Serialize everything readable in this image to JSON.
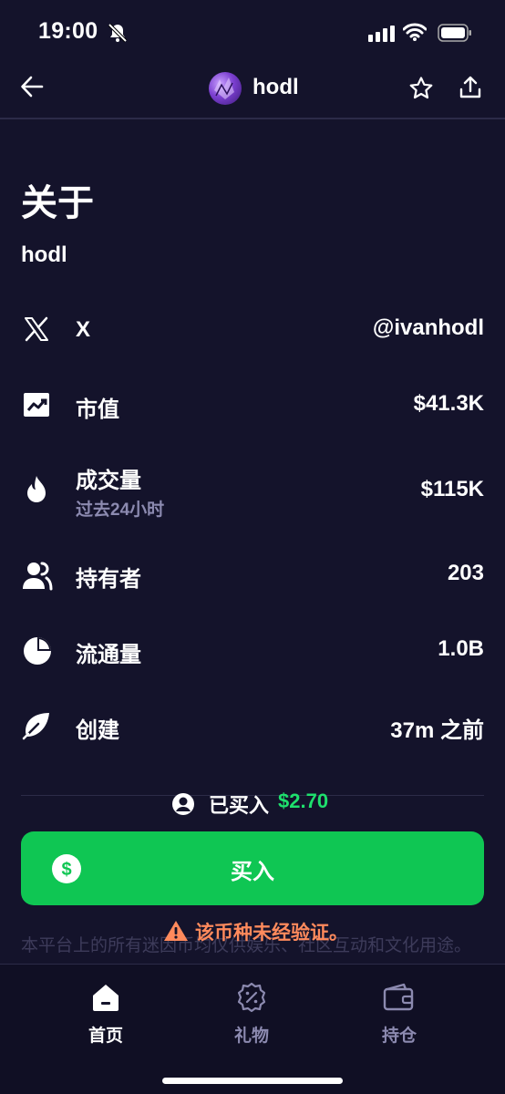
{
  "status_bar": {
    "time": "19:00"
  },
  "header": {
    "token_name": "hodl",
    "icons": [
      "back-arrow-icon",
      "star-icon",
      "share-icon"
    ]
  },
  "about": {
    "title": "关于",
    "token_line": "hodl"
  },
  "stats": [
    {
      "icon": "x-logo-icon",
      "label": "X",
      "value": "@ivanhodl"
    },
    {
      "icon": "trend-up-icon",
      "label": "市值",
      "value": "$41.3K"
    },
    {
      "icon": "flame-icon",
      "label": "成交量",
      "sublabel": "过去24小时",
      "value": "$115K"
    },
    {
      "icon": "users-icon",
      "label": "持有者",
      "value": "203"
    },
    {
      "icon": "pie-chart-icon",
      "label": "流通量",
      "value": "1.0B"
    },
    {
      "icon": "leaf-icon",
      "label": "创建",
      "value": "37m 之前"
    }
  ],
  "bought": {
    "label": "已买入",
    "amount": "$2.70"
  },
  "buy_button": {
    "label": "买入"
  },
  "warning": {
    "text": "该币种未经验证。"
  },
  "disclaimer": "本平台上的所有迷因币均仅供娱乐、社区互动和文化用途。",
  "bottom_nav": [
    {
      "label": "首页",
      "active": true
    },
    {
      "label": "礼物",
      "active": false
    },
    {
      "label": "持仓",
      "active": false
    }
  ],
  "colors": {
    "background": "#14132b",
    "accent_green": "#0fc653",
    "amount_green": "#1ee06d",
    "warning": "#ff8a5c",
    "muted": "#8c8ab0"
  }
}
